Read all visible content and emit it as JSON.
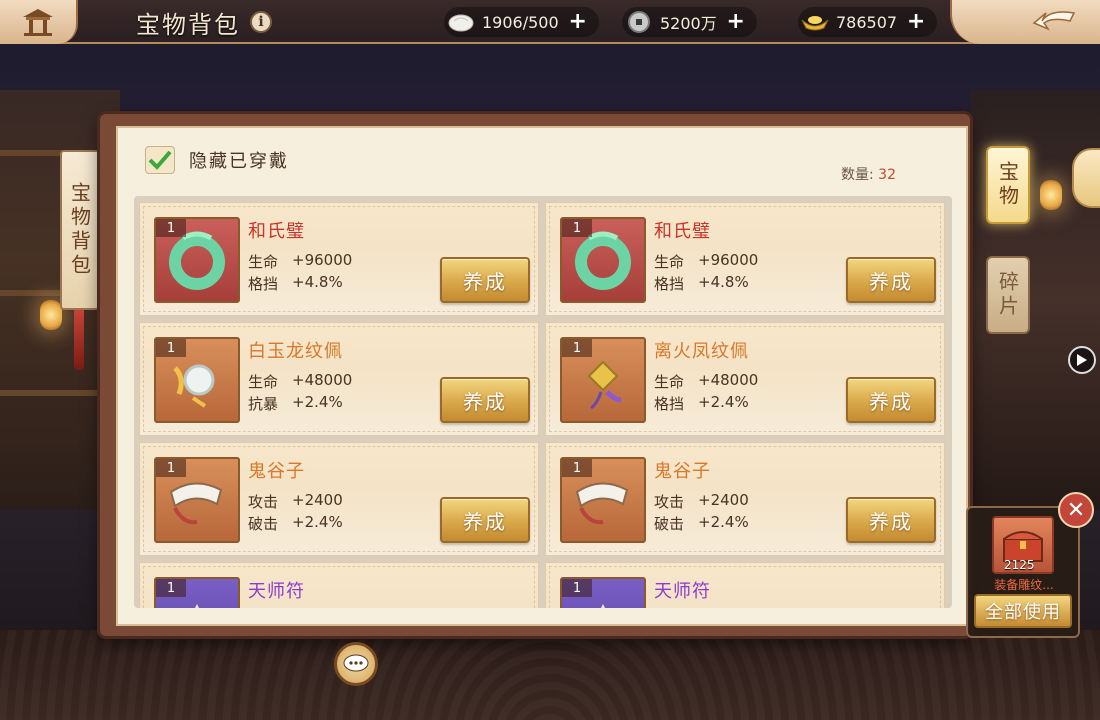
{
  "header": {
    "title": "宝物背包",
    "resources": [
      {
        "icon": "stamina-bun-icon",
        "value": "1906/500"
      },
      {
        "icon": "copper-coin-icon",
        "value": "5200万"
      },
      {
        "icon": "gold-ingot-icon",
        "value": "786507"
      }
    ]
  },
  "sidebar_left": {
    "label": "宝物背包"
  },
  "filter": {
    "hide_equipped_label": "隐藏已穿戴",
    "checked": true
  },
  "count": {
    "label": "数量:",
    "value": "32"
  },
  "items": [
    {
      "level": "1",
      "name": "和氏璧",
      "rarity": "red",
      "stats": [
        [
          "生命",
          "+96000"
        ],
        [
          "格挡",
          "+4.8%"
        ]
      ],
      "button": "养成"
    },
    {
      "level": "1",
      "name": "和氏璧",
      "rarity": "red",
      "stats": [
        [
          "生命",
          "+96000"
        ],
        [
          "格挡",
          "+4.8%"
        ]
      ],
      "button": "养成"
    },
    {
      "level": "1",
      "name": "白玉龙纹佩",
      "rarity": "orange",
      "stats": [
        [
          "生命",
          "+48000"
        ],
        [
          "抗暴",
          "+2.4%"
        ]
      ],
      "button": "养成"
    },
    {
      "level": "1",
      "name": "离火凤纹佩",
      "rarity": "orange",
      "stats": [
        [
          "生命",
          "+48000"
        ],
        [
          "格挡",
          "+2.4%"
        ]
      ],
      "button": "养成"
    },
    {
      "level": "1",
      "name": "鬼谷子",
      "rarity": "orange",
      "stats": [
        [
          "攻击",
          "+2400"
        ],
        [
          "破击",
          "+2.4%"
        ]
      ],
      "button": "养成"
    },
    {
      "level": "1",
      "name": "鬼谷子",
      "rarity": "orange",
      "stats": [
        [
          "攻击",
          "+2400"
        ],
        [
          "破击",
          "+2.4%"
        ]
      ],
      "button": "养成"
    },
    {
      "level": "1",
      "name": "天师符",
      "rarity": "purple",
      "stats": [],
      "button": ""
    },
    {
      "level": "1",
      "name": "天师符",
      "rarity": "purple",
      "stats": [],
      "button": ""
    }
  ],
  "right_tabs": [
    {
      "label": "宝物",
      "active": true
    },
    {
      "label": "碎片",
      "active": false
    }
  ],
  "quick_use": {
    "count": "2125",
    "name": "装备雕纹...",
    "button": "全部使用"
  },
  "colors": {
    "red": "#c9342a",
    "orange": "#d9782a",
    "purple": "#8a3bd0"
  }
}
